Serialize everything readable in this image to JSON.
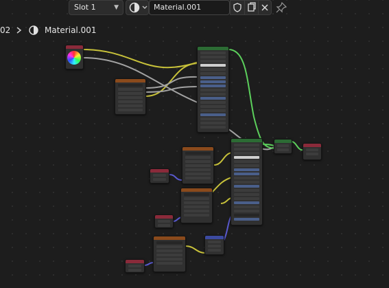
{
  "header": {
    "slot_label": "Slot 1",
    "material_name": "Material.001",
    "icons": {
      "slot_dropdown": "chevron-down-icon",
      "material_browse": "material-sphere-icon",
      "fake_user": "shield-icon",
      "duplicate": "duplicate-icon",
      "unlink": "close-icon",
      "pin": "pin-icon"
    }
  },
  "breadcrumb": {
    "previous_fragment": "02",
    "separator": "chevron-right-icon",
    "current_icon": "material-sphere-icon",
    "current": "Material.001"
  },
  "colors": {
    "background": "#1d1d1d",
    "wire_yellow": "#c8c23a",
    "wire_green": "#5cd05c",
    "wire_gray": "#a3a3a3",
    "wire_blue": "#5a5ad0",
    "header_orange": "#8a4a1c",
    "header_green": "#2c6b34",
    "header_red": "#8a2a3a",
    "header_blue": "#3c4aa0"
  }
}
